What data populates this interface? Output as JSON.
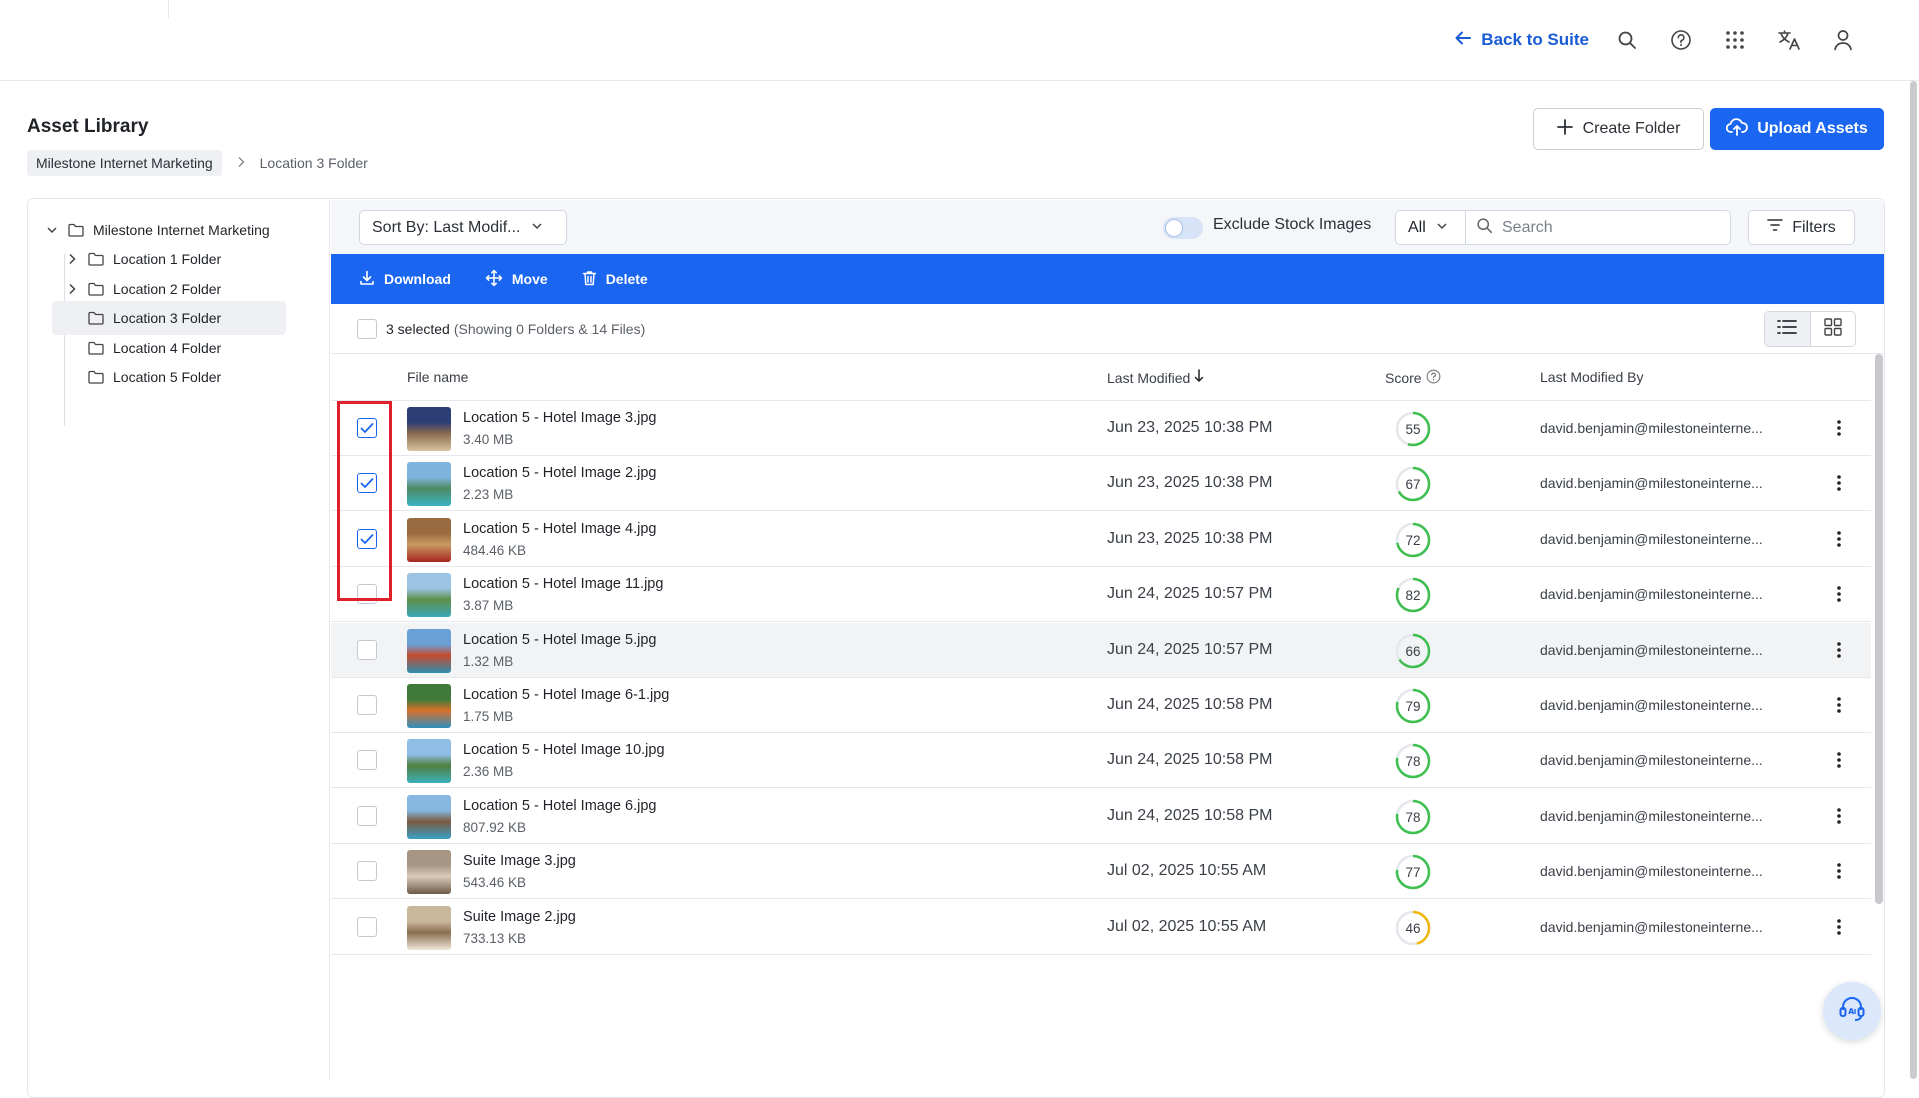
{
  "topbar": {
    "back_label": "Back to Suite",
    "icons": [
      "search-icon",
      "help-icon",
      "apps-grid-icon",
      "translate-icon",
      "user-icon"
    ]
  },
  "header": {
    "title": "Asset Library",
    "breadcrumb": {
      "root": "Milestone Internet Marketing",
      "current": "Location 3 Folder"
    },
    "create_folder_label": "Create Folder",
    "upload_label": "Upload Assets"
  },
  "tree": {
    "root": "Milestone Internet Marketing",
    "items": [
      {
        "label": "Location 1 Folder",
        "expandable": true
      },
      {
        "label": "Location 2 Folder",
        "expandable": true
      },
      {
        "label": "Location 3 Folder",
        "expandable": false,
        "selected": true
      },
      {
        "label": "Location 4 Folder",
        "expandable": false
      },
      {
        "label": "Location 5 Folder",
        "expandable": false
      }
    ]
  },
  "toolbar": {
    "sort_label": "Sort By: Last Modif...",
    "exclude_label": "Exclude Stock Images",
    "exclude_on": false,
    "scope_value": "All",
    "search_placeholder": "Search",
    "filters_label": "Filters"
  },
  "actions": {
    "download": "Download",
    "move": "Move",
    "delete": "Delete"
  },
  "selection": {
    "count_text": "3 selected",
    "summary": "(Showing 0 Folders & 14 Files)"
  },
  "columns": {
    "file_name": "File name",
    "last_modified": "Last Modified",
    "score": "Score",
    "last_modified_by": "Last Modified By"
  },
  "colors": {
    "accent": "#1a66f0",
    "score_green": "#3fbf4f",
    "score_yellow": "#f2b705",
    "highlight": "#e0202a"
  },
  "files": [
    {
      "name": "Location 5 - Hotel Image 3.jpg",
      "size": "3.40 MB",
      "modified": "Jun 23, 2025 10:38 PM",
      "score": 55,
      "by": "david.benjamin@milestoneinterne...",
      "checked": true,
      "thumb": [
        "#2c3e74",
        "#8a6a4e",
        "#d8c3a0"
      ]
    },
    {
      "name": "Location 5 - Hotel Image 2.jpg",
      "size": "2.23 MB",
      "modified": "Jun 23, 2025 10:38 PM",
      "score": 67,
      "by": "david.benjamin@milestoneinterne...",
      "checked": true,
      "thumb": [
        "#7fb4de",
        "#4e8a62",
        "#3bb4c4"
      ]
    },
    {
      "name": "Location 5 - Hotel Image 4.jpg",
      "size": "484.46 KB",
      "modified": "Jun 23, 2025 10:38 PM",
      "score": 72,
      "by": "david.benjamin@milestoneinterne...",
      "checked": true,
      "thumb": [
        "#9a6a40",
        "#c89a62",
        "#a8261f"
      ]
    },
    {
      "name": "Location 5 - Hotel Image 11.jpg",
      "size": "3.87 MB",
      "modified": "Jun 24, 2025 10:57 PM",
      "score": 82,
      "by": "david.benjamin@milestoneinterne...",
      "checked": false,
      "thumb": [
        "#9bc4e4",
        "#5e8f4a",
        "#3aa6b8"
      ]
    },
    {
      "name": "Location 5 - Hotel Image 5.jpg",
      "size": "1.32 MB",
      "modified": "Jun 24, 2025 10:57 PM",
      "score": 66,
      "by": "david.benjamin@milestoneinterne...",
      "checked": false,
      "thumb": [
        "#6aa0d6",
        "#c44a2e",
        "#2f8fb0"
      ]
    },
    {
      "name": "Location 5 - Hotel Image 6-1.jpg",
      "size": "1.75 MB",
      "modified": "Jun 24, 2025 10:58 PM",
      "score": 79,
      "by": "david.benjamin@milestoneinterne...",
      "checked": false,
      "thumb": [
        "#3f7a3a",
        "#d9702a",
        "#2f8fc0"
      ]
    },
    {
      "name": "Location 5 - Hotel Image 10.jpg",
      "size": "2.36 MB",
      "modified": "Jun 24, 2025 10:58 PM",
      "score": 78,
      "by": "david.benjamin@milestoneinterne...",
      "checked": false,
      "thumb": [
        "#8fbde6",
        "#4f7f3e",
        "#3db0b8"
      ]
    },
    {
      "name": "Location 5 - Hotel Image 6.jpg",
      "size": "807.92 KB",
      "modified": "Jun 24, 2025 10:58 PM",
      "score": 78,
      "by": "david.benjamin@milestoneinterne...",
      "checked": false,
      "thumb": [
        "#86b8e2",
        "#7a5a40",
        "#3aa0c8"
      ]
    },
    {
      "name": "Suite Image 3.jpg",
      "size": "543.46 KB",
      "modified": "Jul 02, 2025 10:55 AM",
      "score": 77,
      "by": "david.benjamin@milestoneinterne...",
      "checked": false,
      "thumb": [
        "#a89684",
        "#d8cbb8",
        "#6e5a48"
      ]
    },
    {
      "name": "Suite Image 2.jpg",
      "size": "733.13 KB",
      "modified": "Jul 02, 2025 10:55 AM",
      "score": 46,
      "by": "david.benjamin@milestoneinterne...",
      "checked": false,
      "thumb": [
        "#c9b79c",
        "#8a6e52",
        "#efe6d6"
      ]
    }
  ]
}
